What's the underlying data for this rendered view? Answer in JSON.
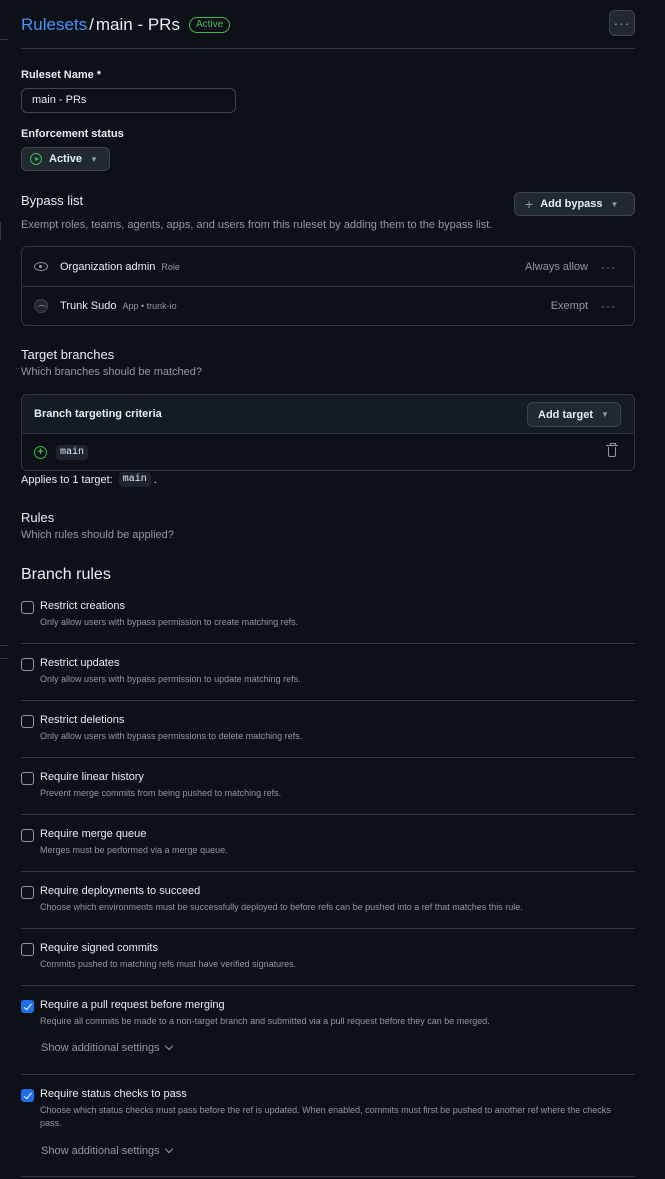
{
  "header": {
    "breadcrumb_link": "Rulesets",
    "separator": "/",
    "title": "main - PRs",
    "status_badge": "Active",
    "menu_icon": "kebab-horizontal-icon"
  },
  "ruleset_name": {
    "label": "Ruleset Name *",
    "value": "main - PRs"
  },
  "enforcement": {
    "label": "Enforcement status",
    "value": "Active",
    "icon": "play-circle-icon"
  },
  "bypass": {
    "title": "Bypass list",
    "description": "Exempt roles, teams, agents, apps, and users from this ruleset by adding them to the bypass list.",
    "add_button": "Add bypass",
    "items": [
      {
        "name": "Organization admin",
        "meta": "Role",
        "status": "Always allow",
        "icon": "eye-icon"
      },
      {
        "name": "Trunk Sudo",
        "meta": "App • trunk-io",
        "status": "Exempt",
        "icon": "app-avatar"
      }
    ]
  },
  "targets": {
    "title": "Target branches",
    "description": "Which branches should be matched?",
    "criteria_title": "Branch targeting criteria",
    "add_button": "Add target",
    "items": [
      {
        "pattern": "main"
      }
    ],
    "applies_prefix": "Applies to 1 target:",
    "applies_value": "main",
    "applies_suffix": "."
  },
  "rules": {
    "title": "Rules",
    "description": "Which rules should be applied?",
    "branch_rules_title": "Branch rules",
    "show_more": "Show additional settings",
    "items": [
      {
        "title": "Restrict creations",
        "desc": "Only allow users with bypass permission to create matching refs.",
        "checked": false
      },
      {
        "title": "Restrict updates",
        "desc": "Only allow users with bypass permission to update matching refs.",
        "checked": false
      },
      {
        "title": "Restrict deletions",
        "desc": "Only allow users with bypass permissions to delete matching refs.",
        "checked": false
      },
      {
        "title": "Require linear history",
        "desc": "Prevent merge commits from being pushed to matching refs.",
        "checked": false
      },
      {
        "title": "Require merge queue",
        "desc": "Merges must be performed via a merge queue.",
        "checked": false
      },
      {
        "title": "Require deployments to succeed",
        "desc": "Choose which environments must be successfully deployed to before refs can be pushed into a ref that matches this rule.",
        "checked": false
      },
      {
        "title": "Require signed commits",
        "desc": "Commits pushed to matching refs must have verified signatures.",
        "checked": false
      },
      {
        "title": "Require a pull request before merging",
        "desc": "Require all commits be made to a non-target branch and submitted via a pull request before they can be merged.",
        "checked": true
      },
      {
        "title": "Require status checks to pass",
        "desc": "Choose which status checks must pass before the ref is updated. When enabled, commits must first be pushed to another ref where the checks pass.",
        "checked": true
      }
    ]
  },
  "colors": {
    "background": "#0d1117",
    "link": "#4493f8",
    "success": "#3fb950",
    "checkbox_checked": "#1f6feb",
    "border": "#30363d"
  }
}
